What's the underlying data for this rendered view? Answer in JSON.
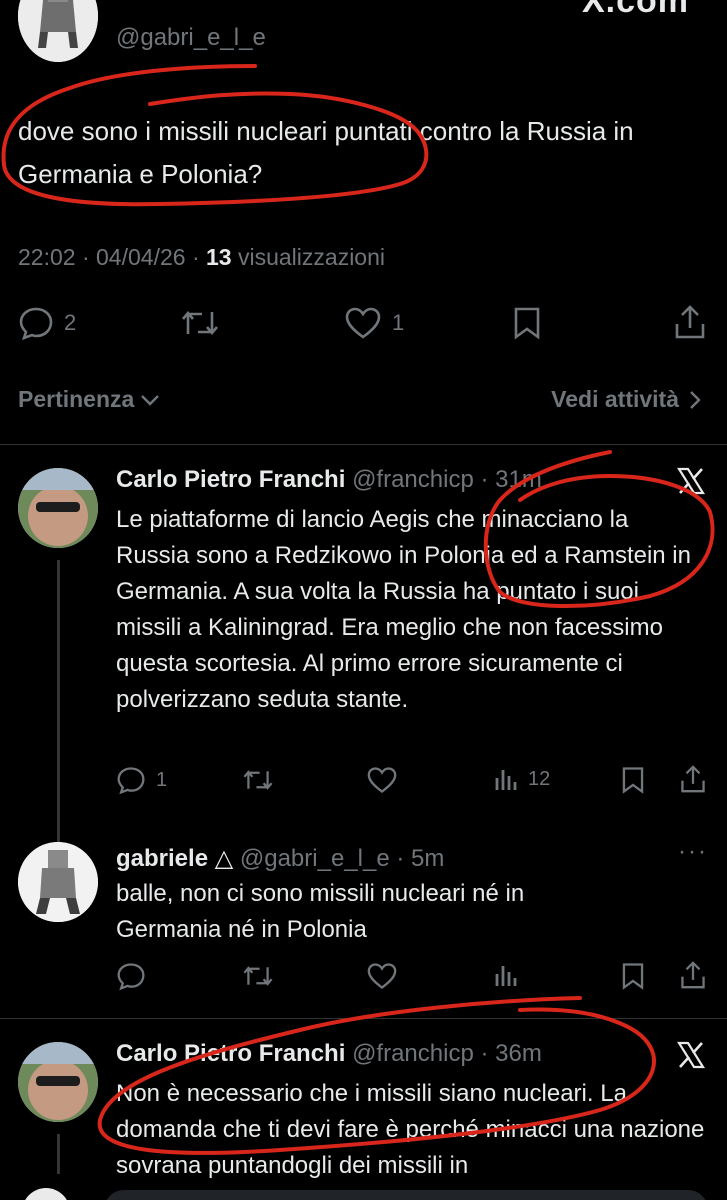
{
  "top_post": {
    "handle": "@gabri_e_l_e",
    "text": "dove sono i missili nucleari puntati contro la Russia in Germania e Polonia?",
    "time": "22:02",
    "date": "04/04/26",
    "views_count": "13",
    "views_label": "visualizzazioni",
    "replies": "2",
    "likes": "1"
  },
  "sort_bar": {
    "relevance": "Pertinenza",
    "activity": "Vedi attività"
  },
  "replies": [
    {
      "name": "Carlo Pietro Franchi",
      "handle": "@franchicp",
      "time": "31m",
      "text": "Le piattaforme di lancio Aegis che minacciano la Russia sono a Redzikowo in Polonia ed a Ramstein in Germania. A sua volta la Russia ha puntato i suoi missili a Kaliningrad. Era meglio che non facessimo questa scortesia. Al primo errore sicuramente ci polverizzano seduta stante.",
      "replies": "1",
      "views": "12"
    },
    {
      "name": "gabriele",
      "name_symbol": "△",
      "handle": "@gabri_e_l_e",
      "time": "5m",
      "text": "balle, non ci sono missili nucleari né in Germania né in Polonia"
    },
    {
      "name": "Carlo Pietro Franchi",
      "handle": "@franchicp",
      "time": "36m",
      "text": "Non è necessario che i missili siano nucleari. La domanda che ti devi fare è perché minacci una nazione sovrana puntandogli dei missili in"
    }
  ],
  "colors": {
    "background": "#000000",
    "text": "#e7e9ea",
    "muted": "#71767b",
    "divider": "#2f3336",
    "annotation": "#d8261b"
  }
}
